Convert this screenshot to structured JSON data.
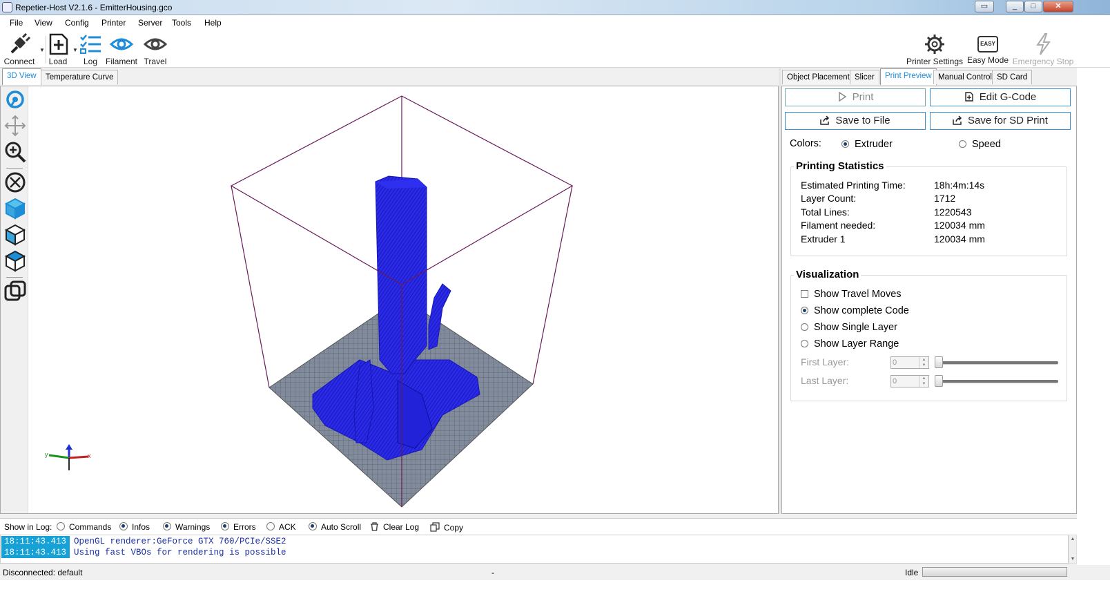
{
  "window": {
    "title": "Repetier-Host V2.1.6 - EmitterHousing.gco",
    "buttons": {
      "restore": "▭",
      "minimize": "_",
      "maximize": "□",
      "close": "✕"
    }
  },
  "menu": [
    "File",
    "View",
    "Config",
    "Printer",
    "Server",
    "Tools",
    "Help"
  ],
  "toolbar": {
    "connect": "Connect",
    "load": "Load",
    "log": "Log",
    "filament": "Filament",
    "travel": "Travel",
    "printer_settings": "Printer Settings",
    "easy_mode": "Easy Mode",
    "easy_badge": "EASY",
    "emergency_stop": "Emergency Stop"
  },
  "left_tabs": [
    "3D View",
    "Temperature Curve"
  ],
  "side_tools": [
    "rotate-icon",
    "move-icon",
    "zoom-icon",
    "fit-view-icon",
    "iso-view-icon",
    "front-view-icon",
    "top-view-icon",
    "parallel-view-icon"
  ],
  "right_tabs": [
    "Object Placement",
    "Slicer",
    "Print Preview",
    "Manual Control",
    "SD Card"
  ],
  "actions": {
    "print": "Print",
    "edit_gcode": "Edit G-Code",
    "save_to_file": "Save to File",
    "save_sd": "Save for SD Print"
  },
  "colors": {
    "label": "Colors:",
    "extruder": "Extruder",
    "speed": "Speed",
    "selected": "Extruder"
  },
  "stats": {
    "title": "Printing Statistics",
    "rows": [
      {
        "label": "Estimated Printing Time:",
        "value": "18h:4m:14s"
      },
      {
        "label": "Layer Count:",
        "value": "1712"
      },
      {
        "label": "Total Lines:",
        "value": "1220543"
      },
      {
        "label": "Filament needed:",
        "value": "120034 mm"
      },
      {
        "label": "Extruder 1",
        "value": "120034 mm"
      }
    ]
  },
  "visualization": {
    "title": "Visualization",
    "show_travel": "Show Travel Moves",
    "show_travel_checked": false,
    "show_complete": "Show complete Code",
    "show_single": "Show Single Layer",
    "show_range": "Show Layer Range",
    "selected": "Show complete Code",
    "first_layer_label": "First Layer:",
    "first_layer_value": "0",
    "last_layer_label": "Last Layer:",
    "last_layer_value": "0"
  },
  "log": {
    "show_label": "Show in Log:",
    "options": [
      {
        "label": "Commands",
        "on": false
      },
      {
        "label": "Infos",
        "on": true
      },
      {
        "label": "Warnings",
        "on": true
      },
      {
        "label": "Errors",
        "on": true
      },
      {
        "label": "ACK",
        "on": false
      },
      {
        "label": "Auto Scroll",
        "on": true
      }
    ],
    "clear": "Clear Log",
    "copy": "Copy",
    "lines": [
      {
        "time": "18:11:43.413",
        "msg": "OpenGL renderer:GeForce GTX 760/PCIe/SSE2"
      },
      {
        "time": "18:11:43.413",
        "msg": "Using fast VBOs for rendering is possible"
      }
    ]
  },
  "status": {
    "left": "Disconnected: default",
    "middle": "-",
    "right": "Idle"
  },
  "scene_colors": {
    "model": "#2a2ae8",
    "bed": "#7b8597",
    "box": "#6a1a5a"
  }
}
